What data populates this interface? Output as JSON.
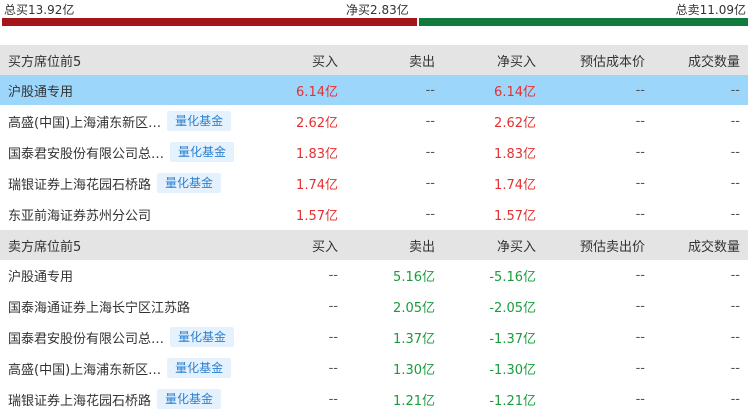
{
  "summary": {
    "total_buy": "总买13.92亿",
    "net_buy": "净买2.83亿",
    "total_sell": "总卖11.09亿",
    "buy_fraction": 0.557
  },
  "buy_section": {
    "headers": [
      "买方席位前5",
      "买入",
      "卖出",
      "净买入",
      "预估成本价",
      "成交数量"
    ],
    "rows": [
      {
        "name": "沪股通专用",
        "badge": "",
        "buy": "6.14亿",
        "sell": "--",
        "net": "6.14亿",
        "est": "--",
        "vol": "--"
      },
      {
        "name": "高盛(中国)上海浦东新区…",
        "badge": "量化基金",
        "buy": "2.62亿",
        "sell": "--",
        "net": "2.62亿",
        "est": "--",
        "vol": "--"
      },
      {
        "name": "国泰君安股份有限公司总…",
        "badge": "量化基金",
        "buy": "1.83亿",
        "sell": "--",
        "net": "1.83亿",
        "est": "--",
        "vol": "--"
      },
      {
        "name": "瑞银证券上海花园石桥路",
        "badge": "量化基金",
        "buy": "1.74亿",
        "sell": "--",
        "net": "1.74亿",
        "est": "--",
        "vol": "--"
      },
      {
        "name": "东亚前海证券苏州分公司",
        "badge": "",
        "buy": "1.57亿",
        "sell": "--",
        "net": "1.57亿",
        "est": "--",
        "vol": "--"
      }
    ]
  },
  "sell_section": {
    "headers": [
      "卖方席位前5",
      "买入",
      "卖出",
      "净买入",
      "预估卖出价",
      "成交数量"
    ],
    "rows": [
      {
        "name": "沪股通专用",
        "badge": "",
        "buy": "--",
        "sell": "5.16亿",
        "net": "-5.16亿",
        "est": "--",
        "vol": "--"
      },
      {
        "name": "国泰海通证券上海长宁区江苏路",
        "badge": "",
        "buy": "--",
        "sell": "2.05亿",
        "net": "-2.05亿",
        "est": "--",
        "vol": "--"
      },
      {
        "name": "国泰君安股份有限公司总…",
        "badge": "量化基金",
        "buy": "--",
        "sell": "1.37亿",
        "net": "-1.37亿",
        "est": "--",
        "vol": "--"
      },
      {
        "name": "高盛(中国)上海浦东新区…",
        "badge": "量化基金",
        "buy": "--",
        "sell": "1.30亿",
        "net": "-1.30亿",
        "est": "--",
        "vol": "--"
      },
      {
        "name": "瑞银证券上海花园石桥路",
        "badge": "量化基金",
        "buy": "--",
        "sell": "1.21亿",
        "net": "-1.21亿",
        "est": "--",
        "vol": "--"
      }
    ]
  },
  "colors": {
    "buy": "#e53030",
    "sell": "#1a9c3c",
    "highlight_row": "#9dd6fb",
    "badge_text": "#2b7fd0"
  }
}
